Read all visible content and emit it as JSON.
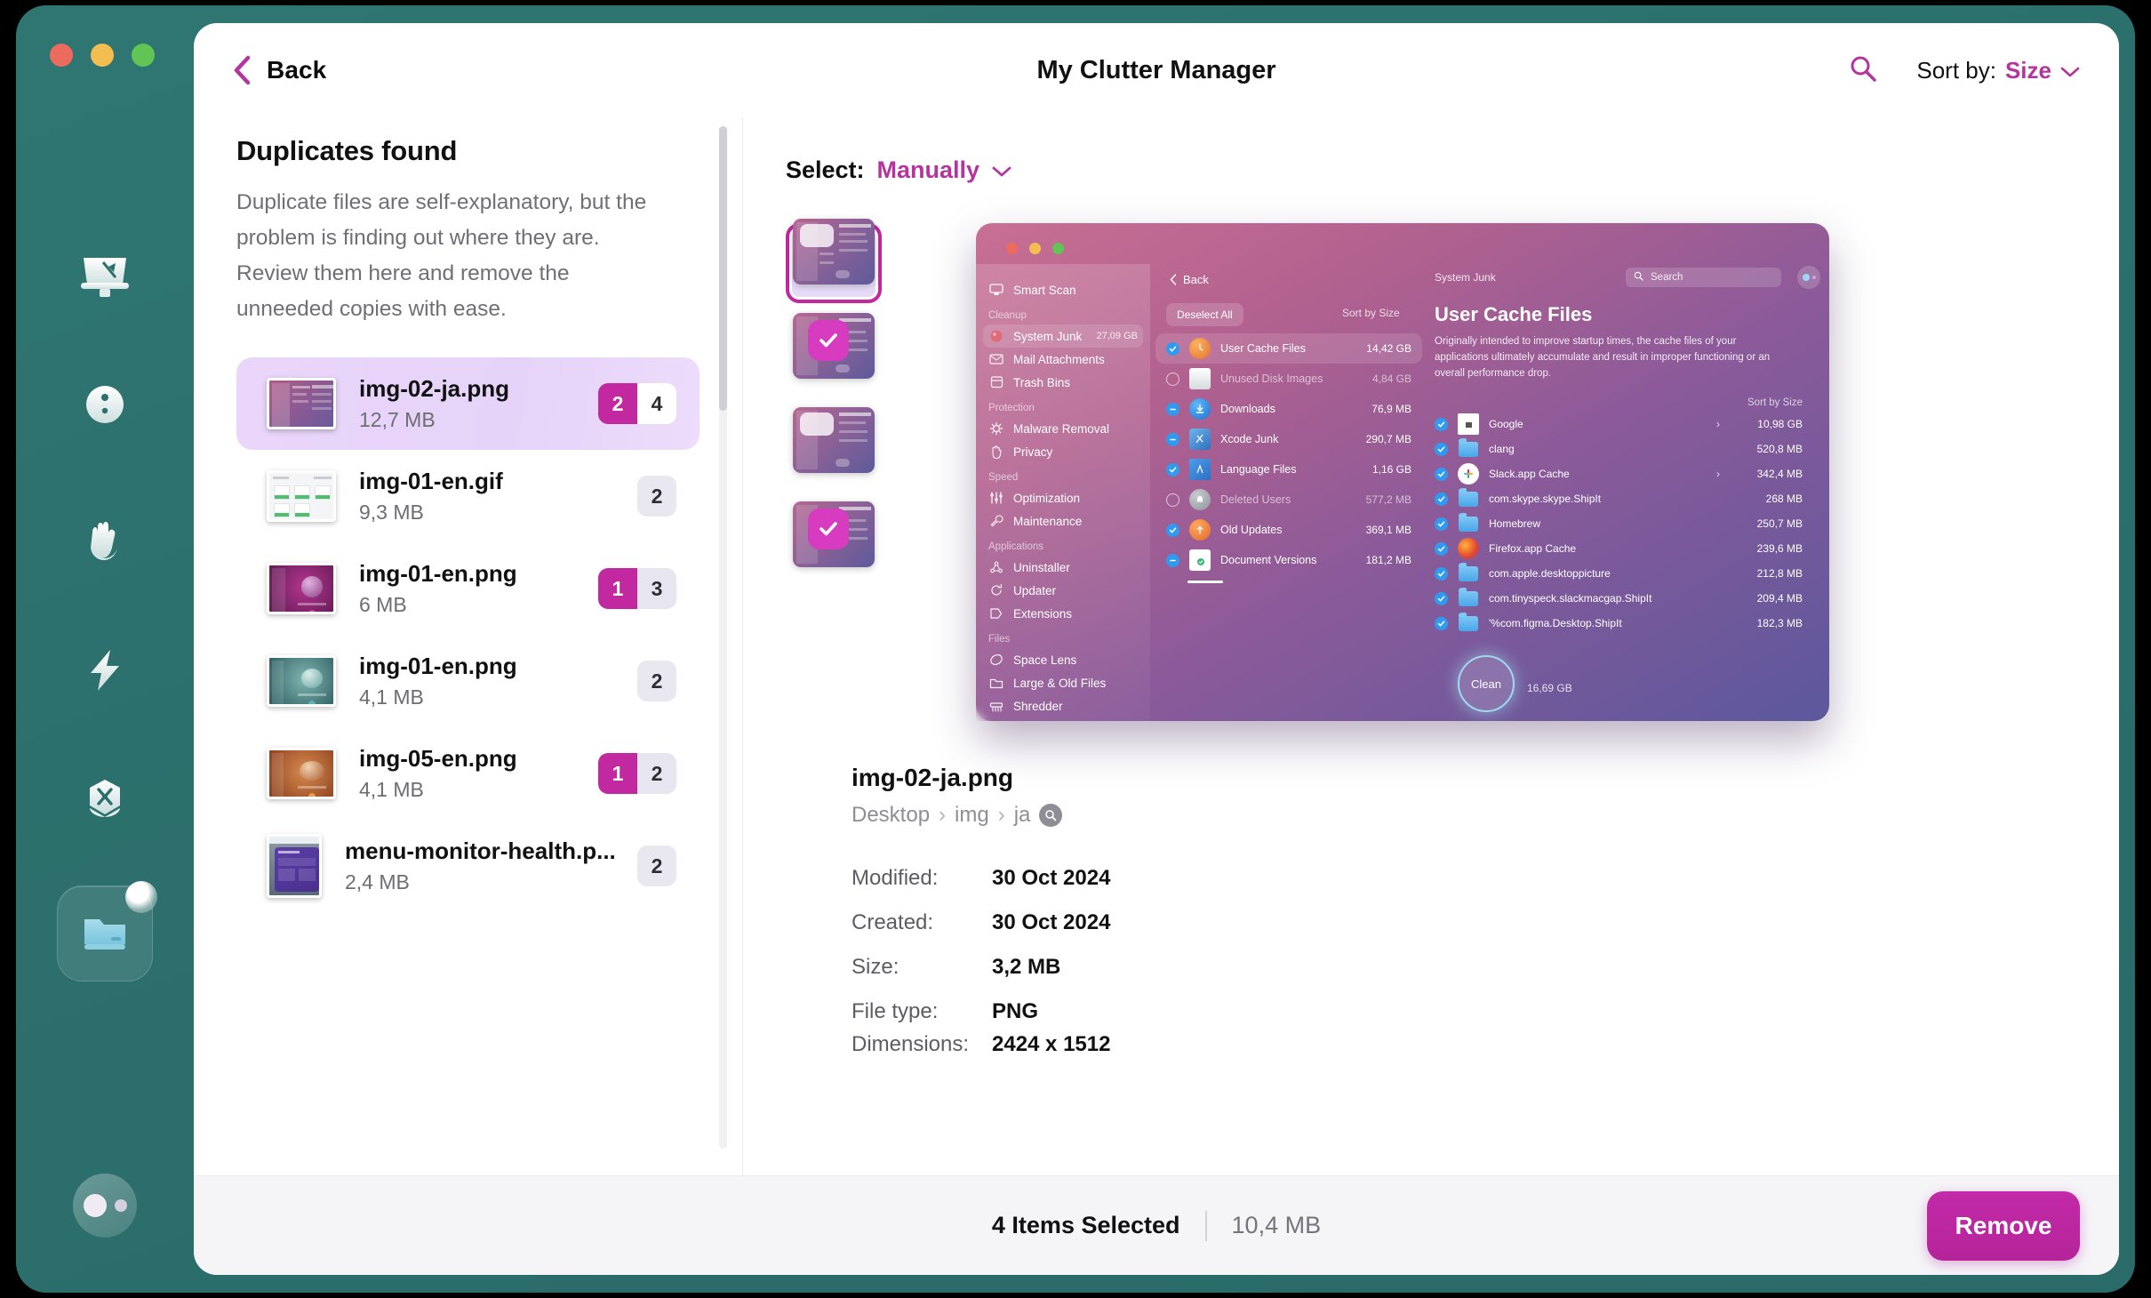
{
  "window": {
    "traffic_lights": [
      "close",
      "minimize",
      "zoom"
    ],
    "title": "My Clutter Manager"
  },
  "dock": {
    "items": [
      {
        "name": "smart-scan",
        "icon": "monitor-icon"
      },
      {
        "name": "malware-removal",
        "icon": "bug-icon"
      },
      {
        "name": "privacy",
        "icon": "hand-icon"
      },
      {
        "name": "speed",
        "icon": "lightning-icon"
      },
      {
        "name": "applications",
        "icon": "hexagon-tools-icon"
      },
      {
        "name": "files",
        "icon": "folder-drive-icon",
        "active": true,
        "badge": true
      }
    ],
    "account": {
      "name": "account-avatar"
    }
  },
  "header": {
    "back_label": "Back",
    "title": "My Clutter Manager",
    "search_icon": "search-icon",
    "sort_key": "Sort by:",
    "sort_value": "Size",
    "sort_chevron": "chevron-down-icon"
  },
  "left_pane": {
    "title": "Duplicates found",
    "description": "Duplicate files are self-explanatory, but the problem is finding out where they are. Review them here and remove the unneeded copies with ease.",
    "files": [
      {
        "name": "img-02-ja.png",
        "size": "12,7 MB",
        "selected_count": "2",
        "total_count": "4",
        "selected": true,
        "thumb": "purple-app-window"
      },
      {
        "name": "img-01-en.gif",
        "size": "9,3 MB",
        "selected_count": null,
        "total_count": "2",
        "selected": false,
        "thumb": "light-dashboard"
      },
      {
        "name": "img-01-en.png",
        "size": "6 MB",
        "selected_count": "1",
        "total_count": "3",
        "selected": false,
        "thumb": "magenta-sphere"
      },
      {
        "name": "img-01-en.png",
        "size": "4,1 MB",
        "selected_count": null,
        "total_count": "2",
        "selected": false,
        "thumb": "teal-sphere"
      },
      {
        "name": "img-05-en.png",
        "size": "4,1 MB",
        "selected_count": "1",
        "total_count": "2",
        "selected": false,
        "thumb": "orange-sphere"
      },
      {
        "name": "menu-monitor-health.p...",
        "size": "2,4 MB",
        "selected_count": null,
        "total_count": "2",
        "selected": false,
        "thumb": "menu-panel"
      }
    ]
  },
  "right_pane": {
    "select_key": "Select:",
    "select_value": "Manually",
    "select_chevron": "chevron-down-icon",
    "thumbnails": [
      {
        "index": 1,
        "selected": true,
        "checked": false
      },
      {
        "index": 2,
        "selected": false,
        "checked": true
      },
      {
        "index": 3,
        "selected": false,
        "checked": false
      },
      {
        "index": 4,
        "selected": false,
        "checked": true
      }
    ],
    "preview": {
      "back_label": "Back",
      "deselect_all_label": "Deselect All",
      "sort_label_middle": "Sort by Size",
      "breadcrumb": "System Junk",
      "search_placeholder": "Search",
      "heading": "User Cache Files",
      "paragraph": "Originally intended to improve startup times, the cache files of your applications ultimately accumulate and result in improper functioning or an overall performance drop.",
      "sort_label_right": "Sort by Size",
      "sidebar": [
        {
          "label": "Smart Scan",
          "type": "item",
          "icon": "monitor-icon"
        },
        {
          "label": "Cleanup",
          "type": "section"
        },
        {
          "label": "System Junk",
          "type": "item",
          "icon": "junk-icon",
          "size": "27,09 GB",
          "highlight": true
        },
        {
          "label": "Mail Attachments",
          "type": "item",
          "icon": "mail-icon"
        },
        {
          "label": "Trash Bins",
          "type": "item",
          "icon": "trash-icon"
        },
        {
          "label": "Protection",
          "type": "section"
        },
        {
          "label": "Malware Removal",
          "type": "item",
          "icon": "bug-icon"
        },
        {
          "label": "Privacy",
          "type": "item",
          "icon": "hand-icon"
        },
        {
          "label": "Speed",
          "type": "section"
        },
        {
          "label": "Optimization",
          "type": "item",
          "icon": "sliders-icon"
        },
        {
          "label": "Maintenance",
          "type": "item",
          "icon": "wrench-icon"
        },
        {
          "label": "Applications",
          "type": "section"
        },
        {
          "label": "Uninstaller",
          "type": "item",
          "icon": "uninstall-icon"
        },
        {
          "label": "Updater",
          "type": "item",
          "icon": "update-icon"
        },
        {
          "label": "Extensions",
          "type": "item",
          "icon": "extensions-icon"
        },
        {
          "label": "Files",
          "type": "section"
        },
        {
          "label": "Space Lens",
          "type": "item",
          "icon": "lens-icon"
        },
        {
          "label": "Large & Old Files",
          "type": "item",
          "icon": "folder-icon"
        },
        {
          "label": "Shredder",
          "type": "item",
          "icon": "shredder-icon"
        }
      ],
      "categories": [
        {
          "label": "User Cache Files",
          "size": "14,42 GB",
          "state": "checked",
          "highlight": true,
          "icon": "clock-user-icon"
        },
        {
          "label": "Unused Disk Images",
          "size": "4,84 GB",
          "state": "empty",
          "icon": "disk-icon"
        },
        {
          "label": "Downloads",
          "size": "76,9 MB",
          "state": "partial",
          "icon": "download-icon"
        },
        {
          "label": "Xcode Junk",
          "size": "290,7 MB",
          "state": "partial",
          "icon": "xcode-icon"
        },
        {
          "label": "Language Files",
          "size": "1,16 GB",
          "state": "checked",
          "icon": "flag-icon"
        },
        {
          "label": "Deleted Users",
          "size": "577,2 MB",
          "state": "empty",
          "icon": "ghost-icon"
        },
        {
          "label": "Old Updates",
          "size": "369,1 MB",
          "state": "checked",
          "icon": "update-clock-icon"
        },
        {
          "label": "Document Versions",
          "size": "181,2 MB",
          "state": "partial",
          "icon": "document-check-icon"
        }
      ],
      "files": [
        {
          "label": "Google",
          "size": "10,98 GB",
          "arrow": true,
          "icon": "doc-icon"
        },
        {
          "label": "clang",
          "size": "520,8 MB",
          "arrow": false,
          "icon": "folder-icon"
        },
        {
          "label": "Slack.app Cache",
          "size": "342,4 MB",
          "arrow": true,
          "icon": "slack-icon"
        },
        {
          "label": "com.skype.skype.ShipIt",
          "size": "268 MB",
          "arrow": false,
          "icon": "folder-icon"
        },
        {
          "label": "Homebrew",
          "size": "250,7 MB",
          "arrow": false,
          "icon": "folder-icon"
        },
        {
          "label": "Firefox.app Cache",
          "size": "239,6 MB",
          "arrow": false,
          "icon": "firefox-icon"
        },
        {
          "label": "com.apple.desktoppicture",
          "size": "212,8 MB",
          "arrow": false,
          "icon": "folder-icon"
        },
        {
          "label": "com.tinyspeck.slackmacgap.ShipIt",
          "size": "209,4 MB",
          "arrow": false,
          "icon": "folder-icon"
        },
        {
          "label": "'%com.figma.Desktop.ShipIt",
          "size": "182,3 MB",
          "arrow": false,
          "icon": "folder-icon"
        }
      ],
      "clean_button": "Clean",
      "clean_size": "16,69 GB"
    },
    "details": {
      "name": "img-02-ja.png",
      "path": [
        "Desktop",
        "img",
        "ja"
      ],
      "path_badge_icon": "reveal-icon",
      "rows": [
        {
          "key": "Modified:",
          "value": "30 Oct 2024"
        },
        {
          "key": "Created:",
          "value": "30 Oct 2024"
        },
        {
          "key": "Size:",
          "value": "3,2 MB"
        },
        {
          "key": "File type:",
          "value": "PNG"
        },
        {
          "key": "Dimensions:",
          "value": "2424 x 1512"
        }
      ]
    }
  },
  "footer": {
    "selected_label": "4 Items Selected",
    "selected_size": "10,4 MB",
    "remove_label": "Remove"
  },
  "colors": {
    "accent": "#b5359e",
    "accent_strong": "#c2289f",
    "dock_bg": "#2c6f6c",
    "selection_bg": "#e8d5f9"
  }
}
